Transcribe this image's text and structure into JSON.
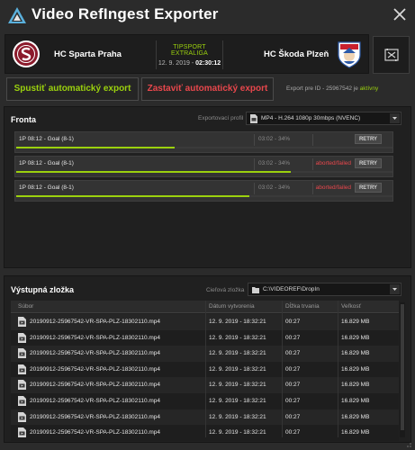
{
  "app": {
    "title": "Video RefIngest Exporter"
  },
  "match": {
    "home_team": "HC Sparta Praha",
    "away_team": "HC Škoda Plzeň",
    "league": "TIPSPORT EXTRALIGA",
    "date": "12. 9. 2019 -",
    "time": "02:30:12"
  },
  "actions": {
    "start_label": "Spustiť automatický export",
    "stop_label": "Zastaviť automatický export",
    "export_id_prefix": "Export pre ID - 25967542 je",
    "export_status": "aktívny"
  },
  "queue": {
    "title": "Fronta",
    "profile_label": "Exportovací profil",
    "profile_value": "MP4 - H.264 1080p 30mbps (NVENC)",
    "items": [
      {
        "name": "1P 08:12 - Goal (8-1)",
        "progress": "03:02 - 34%",
        "status": "",
        "retry": "RETRY",
        "fraction": 0.42
      },
      {
        "name": "1P 08:12 - Goal (8-1)",
        "progress": "03:02 - 34%",
        "status": "aborted/failed",
        "retry": "RETRY",
        "fraction": 0.73
      },
      {
        "name": "1P 08:12 - Goal (8-1)",
        "progress": "03:02 - 34%",
        "status": "aborted/failed",
        "retry": "RETRY",
        "fraction": 0.62
      }
    ]
  },
  "output": {
    "title": "Výstupná zložka",
    "folder_label": "Cieľová zložka",
    "folder_value": "C:\\VIDEOREF\\DropIn",
    "columns": [
      "Súbor",
      "Dátum vytvorenia",
      "Dĺžka trvania",
      "Veľkosť"
    ],
    "rows": [
      [
        "20190912-25967542-VR-SPA-PLZ-18302110.mp4",
        "12. 9. 2019 - 18:32:21",
        "00:27",
        "16.829 MB"
      ],
      [
        "20190912-25967542-VR-SPA-PLZ-18302110.mp4",
        "12. 9. 2019 - 18:32:21",
        "00:27",
        "16.829 MB"
      ],
      [
        "20190912-25967542-VR-SPA-PLZ-18302110.mp4",
        "12. 9. 2019 - 18:32:21",
        "00:27",
        "16.829 MB"
      ],
      [
        "20190912-25967542-VR-SPA-PLZ-18302110.mp4",
        "12. 9. 2019 - 18:32:21",
        "00:27",
        "16.829 MB"
      ],
      [
        "20190912-25967542-VR-SPA-PLZ-18302110.mp4",
        "12. 9. 2019 - 18:32:21",
        "00:27",
        "16.829 MB"
      ],
      [
        "20190912-25967542-VR-SPA-PLZ-18302110.mp4",
        "12. 9. 2019 - 18:32:21",
        "00:27",
        "16.829 MB"
      ],
      [
        "20190912-25967542-VR-SPA-PLZ-18302110.mp4",
        "12. 9. 2019 - 18:32:21",
        "00:27",
        "16.829 MB"
      ],
      [
        "20190912-25967542-VR-SPA-PLZ-18302110.mp4",
        "12. 9. 2019 - 18:32:21",
        "00:27",
        "16.829 MB"
      ]
    ]
  },
  "colors": {
    "accent_green": "#9bd10e",
    "accent_red": "#e8474c",
    "background": "#2b2b2b"
  },
  "icons": [
    "app-logo-icon",
    "close-icon",
    "sparta-logo-icon",
    "plzen-logo-icon",
    "settings-icon",
    "video-file-icon",
    "folder-icon",
    "chevron-down-icon"
  ]
}
